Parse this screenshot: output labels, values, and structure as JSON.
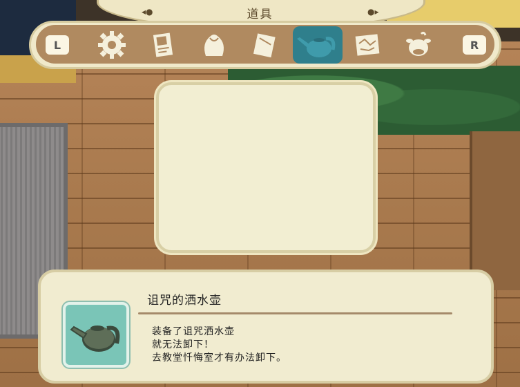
{
  "title": {
    "text": "道具",
    "left_ornament": "◂●",
    "right_ornament": "●▸"
  },
  "tabs": {
    "left_shoulder": "L",
    "right_shoulder": "R",
    "items": [
      {
        "icon": "gear-icon"
      },
      {
        "icon": "paper-notes-icon"
      },
      {
        "icon": "seed-bag-icon"
      },
      {
        "icon": "envelope-icon"
      },
      {
        "icon": "watering-can-icon",
        "selected": true
      },
      {
        "icon": "map-icon"
      },
      {
        "icon": "cow-icon"
      }
    ],
    "selected_color": "#2f7f8c",
    "icon_color": "#f5f0dc"
  },
  "item": {
    "name": "诅咒的洒水壶",
    "description": [
      "装备了诅咒洒水壶",
      "就无法卸下！",
      "去教堂忏悔室才有办法卸下。"
    ],
    "slot_color": "#7ac5b7",
    "icon": "cursed-watering-can-icon"
  }
}
